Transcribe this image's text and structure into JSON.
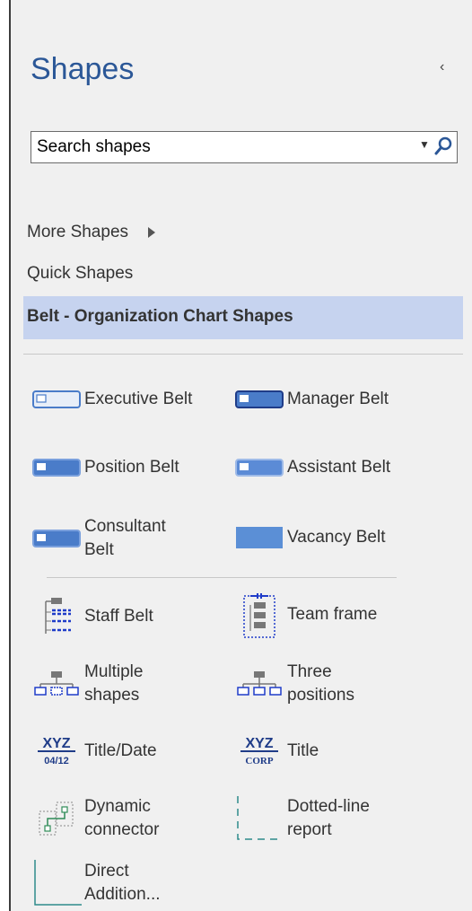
{
  "panel": {
    "title": "Shapes",
    "collapse_glyph": "‹"
  },
  "search": {
    "placeholder": "Search shapes",
    "value": "Search shapes",
    "dropdown_glyph": "▼"
  },
  "nav": {
    "more_shapes": "More Shapes",
    "quick_shapes": "Quick Shapes",
    "stencil": "Belt - Organization Chart Shapes"
  },
  "shapes": [
    {
      "label": "Executive Belt",
      "icon": "executive-belt-icon"
    },
    {
      "label": "Manager Belt",
      "icon": "manager-belt-icon"
    },
    {
      "label": "Position Belt",
      "icon": "position-belt-icon"
    },
    {
      "label": "Assistant Belt",
      "icon": "assistant-belt-icon"
    },
    {
      "label": "Consultant\nBelt",
      "icon": "consultant-belt-icon"
    },
    {
      "label": "Vacancy Belt",
      "icon": "vacancy-belt-icon"
    },
    {
      "label": "Staff Belt",
      "icon": "staff-belt-icon"
    },
    {
      "label": "Team frame",
      "icon": "team-frame-icon"
    },
    {
      "label": "Multiple\nshapes",
      "icon": "multiple-shapes-icon"
    },
    {
      "label": "Three\npositions",
      "icon": "three-positions-icon"
    },
    {
      "label": "Title/Date",
      "icon": "title-date-icon"
    },
    {
      "label": "Title",
      "icon": "title-icon"
    },
    {
      "label": "Dynamic\nconnector",
      "icon": "dynamic-connector-icon"
    },
    {
      "label": "Dotted-line\nreport",
      "icon": "dotted-line-report-icon"
    },
    {
      "label": "Direct\nAddition...",
      "icon": "direct-addition-icon"
    }
  ],
  "icon_text": {
    "xyz": "XYZ",
    "date": "04/12",
    "corp": "CORP"
  },
  "colors": {
    "title": "#2b5797",
    "stencil_bg": "#c6d3ef",
    "belt_blue": "#4a7cc9",
    "dark_blue": "#1f3c88"
  }
}
